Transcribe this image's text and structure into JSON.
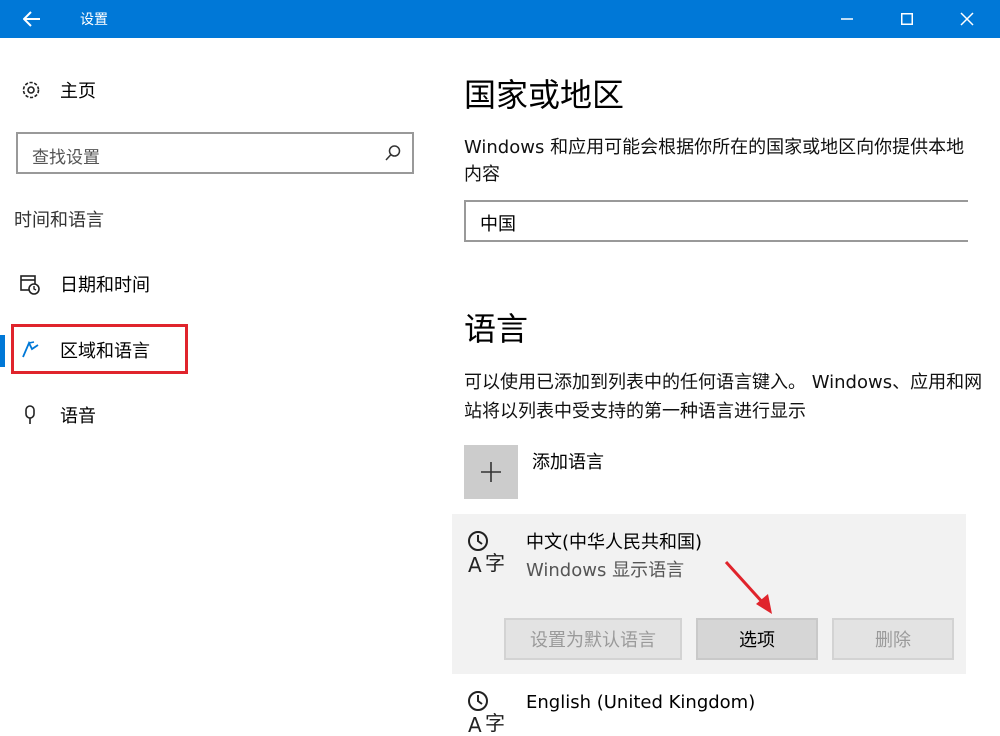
{
  "window": {
    "title": "设置",
    "accent": "#0078d7"
  },
  "sidebar": {
    "home_label": "主页",
    "search_placeholder": "查找设置",
    "section_title": "时间和语言",
    "items": [
      {
        "label": "日期和时间",
        "icon": "clock-calendar-icon"
      },
      {
        "label": "区域和语言",
        "icon": "region-language-icon",
        "selected": true
      },
      {
        "label": "语音",
        "icon": "microphone-icon"
      }
    ]
  },
  "main": {
    "region_heading": "国家或地区",
    "region_desc": "Windows 和应用可能会根据你所在的国家或地区向你提供本地内容",
    "country_value": "中国",
    "language_heading": "语言",
    "language_desc": "可以使用已添加到列表中的任何语言键入。 Windows、应用和网站将以列表中受支持的第一种语言进行显示",
    "add_language_label": "添加语言",
    "languages": [
      {
        "name": "中文(中华人民共和国)",
        "subtitle": "Windows 显示语言",
        "buttons": {
          "set_default": "设置为默认语言",
          "options": "选项",
          "remove": "删除"
        }
      },
      {
        "name": "English (United Kingdom)"
      }
    ]
  },
  "annotations": {
    "highlight_color": "#e0242c"
  }
}
